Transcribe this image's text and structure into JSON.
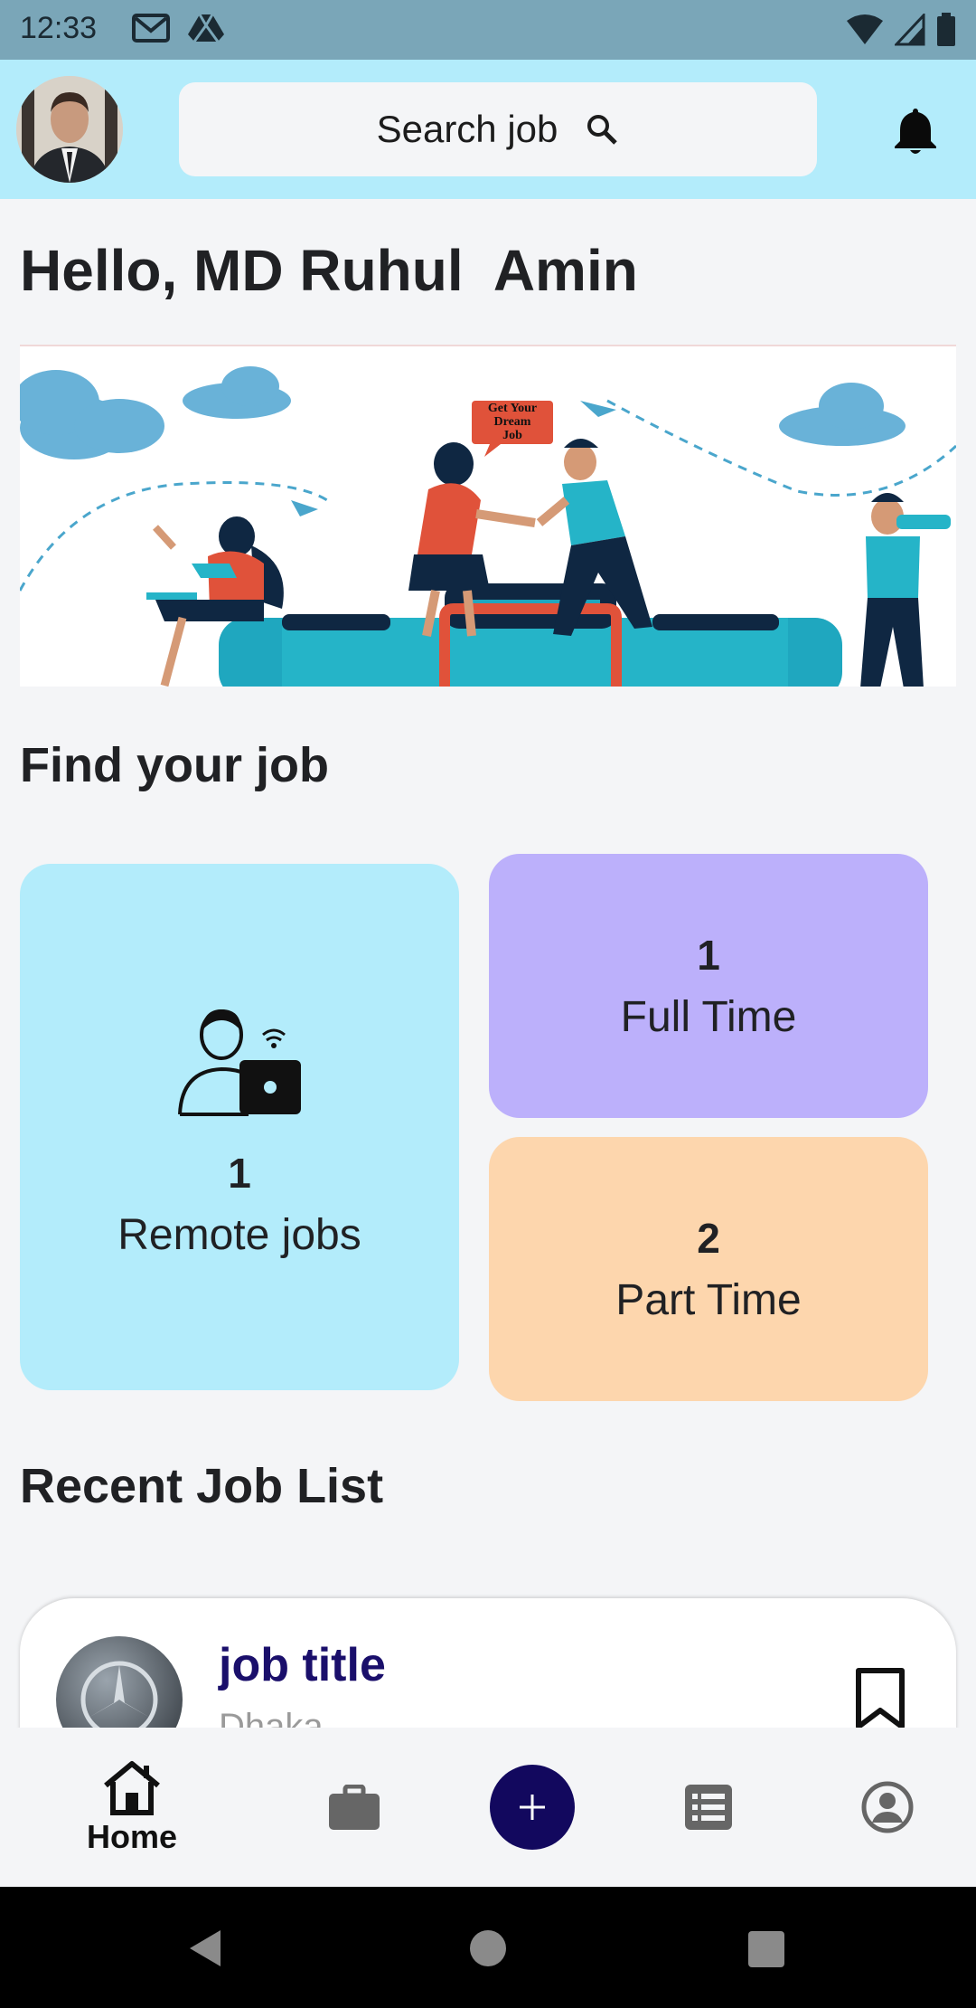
{
  "status_bar": {
    "time": "12:33",
    "left_icons": [
      "gmail-icon",
      "drive-icon"
    ],
    "right_icons": [
      "wifi-icon",
      "signal-icon",
      "battery-icon"
    ]
  },
  "header": {
    "search_label": "Search job",
    "avatar": "avatar-icon",
    "notification": "bell-icon"
  },
  "greeting": "Hello, MD Ruhul  Amin",
  "banner": {
    "sign_text": [
      "Get Your",
      "Dream",
      "Job"
    ]
  },
  "find_section": {
    "title": "Find your job",
    "cards": {
      "remote": {
        "count": "1",
        "label": "Remote jobs"
      },
      "full_time": {
        "count": "1",
        "label": "Full Time"
      },
      "part_time": {
        "count": "2",
        "label": "Part Time"
      }
    }
  },
  "recent_section": {
    "title": "Recent Job List",
    "jobs": [
      {
        "title": "job title",
        "location": "Dhaka"
      }
    ]
  },
  "bottom_nav": {
    "home_label": "Home",
    "items": [
      "home-icon",
      "briefcase-icon",
      "add-icon",
      "list-icon",
      "profile-icon"
    ]
  },
  "colors": {
    "header_bg": "#b3ecfb",
    "remote_card": "#b3ecfb",
    "full_time_card": "#bcb0fb",
    "part_time_card": "#fdd6ad",
    "accent": "#12085e"
  }
}
